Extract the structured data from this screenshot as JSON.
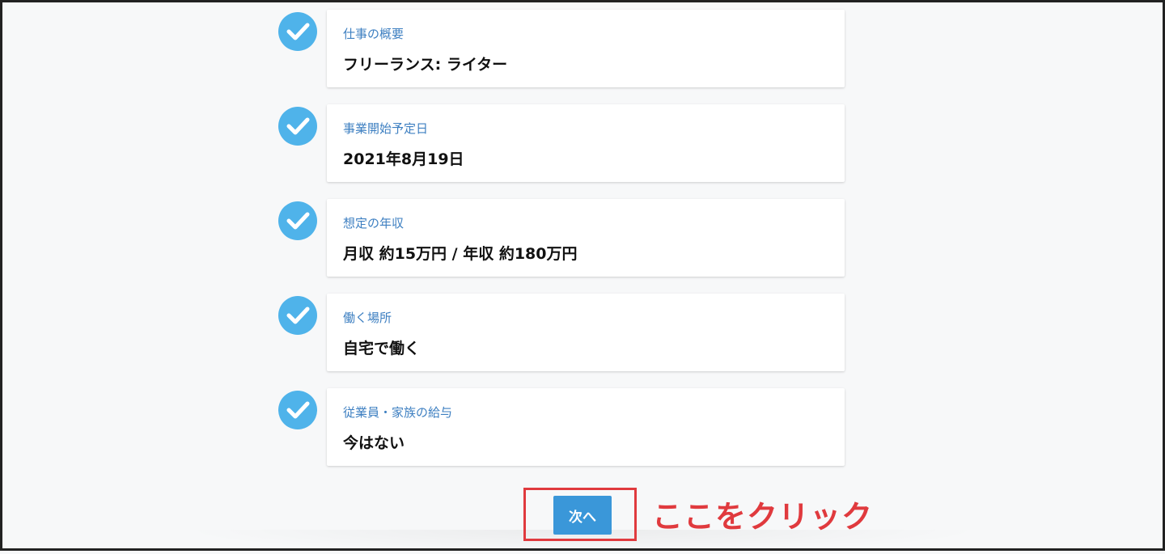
{
  "items": [
    {
      "label": "仕事の概要",
      "value": "フリーランス: ライター"
    },
    {
      "label": "事業開始予定日",
      "value": "2021年8月19日"
    },
    {
      "label": "想定の年収",
      "value": "月収 約15万円 / 年収 約180万円"
    },
    {
      "label": "働く場所",
      "value": "自宅で働く"
    },
    {
      "label": "従業員・家族の給与",
      "value": "今はない"
    }
  ],
  "next_button": {
    "label": "次へ"
  },
  "annotation": {
    "text": "ここをクリック"
  },
  "colors": {
    "check": "#4fb3ea",
    "label": "#3d7fc1",
    "button": "#3a97d9",
    "highlight": "#e03a3e"
  }
}
